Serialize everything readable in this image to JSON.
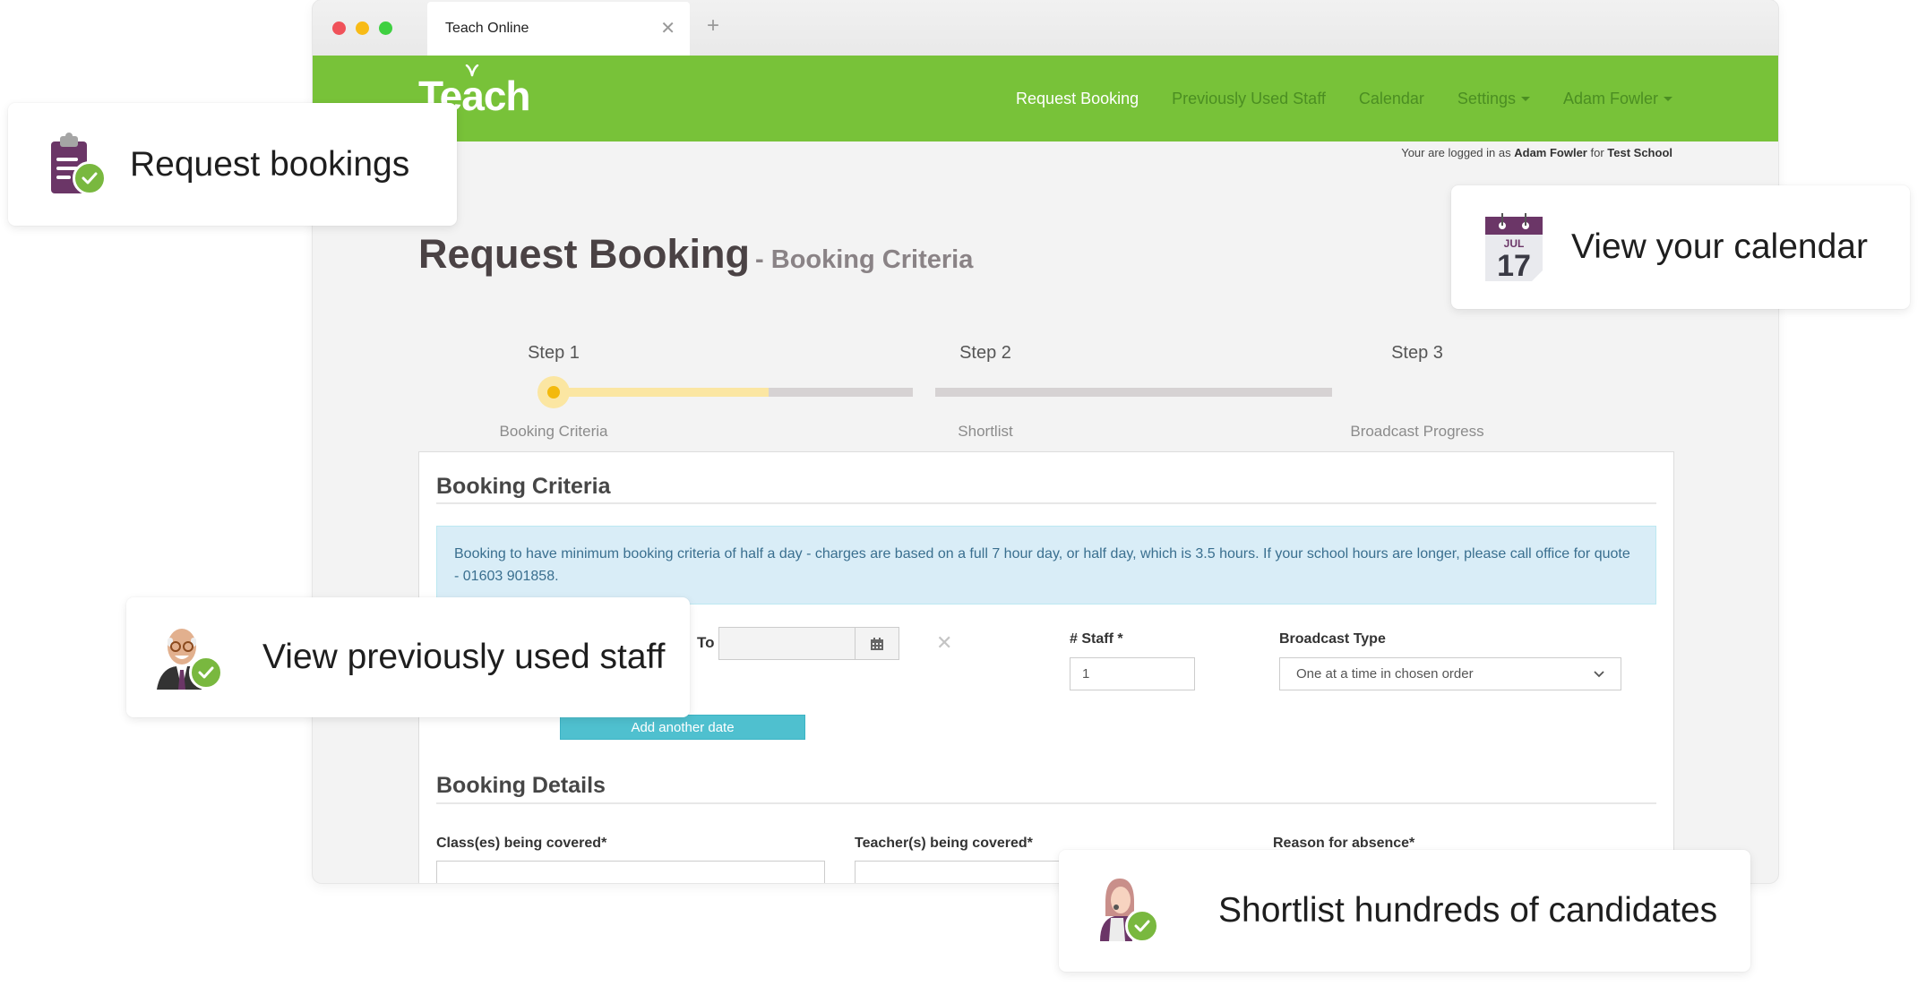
{
  "browser": {
    "tab_title": "Teach Online",
    "tab_close": "✕",
    "new_tab": "+"
  },
  "navbar": {
    "logo": "Teach",
    "items": [
      {
        "label": "Request Booking",
        "active": true
      },
      {
        "label": "Previously Used Staff"
      },
      {
        "label": "Calendar"
      },
      {
        "label": "Settings",
        "dropdown": true
      },
      {
        "label": "Adam Fowler",
        "dropdown": true
      }
    ],
    "brand_color": "#78c239"
  },
  "login_status": {
    "prefix": "Your are logged in as",
    "user": "Adam Fowler",
    "middle": "for",
    "school": "Test School"
  },
  "page": {
    "title": "Request Booking",
    "subtitle": "- Booking Criteria"
  },
  "stepper": {
    "steps": [
      {
        "label": "Step 1",
        "description": "Booking Criteria",
        "state": "active"
      },
      {
        "label": "Step 2",
        "description": "Shortlist",
        "state": "pending"
      },
      {
        "label": "Step 3",
        "description": "Broadcast Progress",
        "state": "pending"
      }
    ],
    "progress_fraction_step1_segment": 0.5
  },
  "booking_criteria": {
    "heading": "Booking Criteria",
    "alert": "Booking to have minimum booking criteria of half a day - charges are based on a full 7 hour day, or half day, which is 3.5 hours. If your school hours are longer, please call office for quote - 01603 901858.",
    "to_label": "To",
    "to_value": "",
    "remove_date": "✕",
    "staff_label": "# Staff *",
    "staff_value": "1",
    "broadcast_label": "Broadcast Type",
    "broadcast_value": "One at a time in chosen order",
    "add_date_button": "Add another date"
  },
  "booking_details": {
    "heading": "Booking Details",
    "fields": [
      {
        "label": "Class(es) being covered*",
        "value": ""
      },
      {
        "label": "Teacher(s) being covered*",
        "value": ""
      },
      {
        "label": "Reason for absence*",
        "value": ""
      }
    ]
  },
  "feature_cards": [
    {
      "text": "Request bookings",
      "icon": "clipboard-check-icon"
    },
    {
      "text": "View your calendar",
      "icon": "calendar-icon",
      "calendar_month": "JUL",
      "calendar_day": "17"
    },
    {
      "text": "View previously used staff",
      "icon": "staff-check-icon"
    },
    {
      "text": "Shortlist hundreds of candidates",
      "icon": "candidate-check-icon"
    }
  ]
}
